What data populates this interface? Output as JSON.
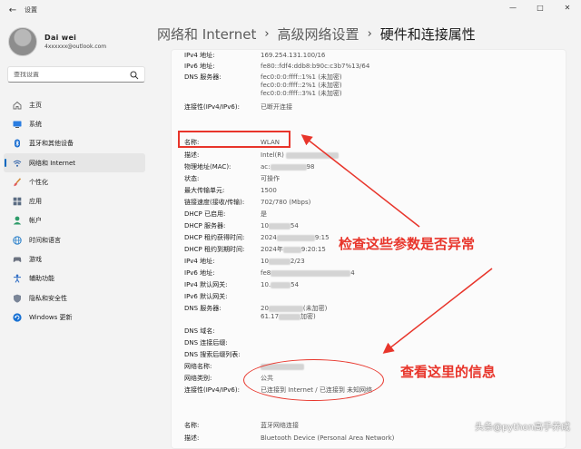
{
  "app": {
    "title": "设置"
  },
  "profile": {
    "name": "Dai wei",
    "email": "4xxxxxx@outlook.com"
  },
  "search": {
    "placeholder": "查找设置"
  },
  "nav": [
    {
      "label": "主页",
      "icon": "home-icon"
    },
    {
      "label": "系统",
      "icon": "system-icon"
    },
    {
      "label": "蓝牙和其他设备",
      "icon": "bluetooth-icon"
    },
    {
      "label": "网络和 Internet",
      "icon": "wifi-icon",
      "active": true
    },
    {
      "label": "个性化",
      "icon": "brush-icon"
    },
    {
      "label": "应用",
      "icon": "apps-icon"
    },
    {
      "label": "帐户",
      "icon": "account-icon"
    },
    {
      "label": "时间和语言",
      "icon": "globe-icon"
    },
    {
      "label": "游戏",
      "icon": "gamepad-icon"
    },
    {
      "label": "辅助功能",
      "icon": "accessibility-icon"
    },
    {
      "label": "隐私和安全性",
      "icon": "shield-icon"
    },
    {
      "label": "Windows 更新",
      "icon": "update-icon"
    }
  ],
  "breadcrumb": {
    "level1": "网络和 Internet",
    "level2": "高级网络设置",
    "level3": "硬件和连接属性"
  },
  "props": {
    "ipv4_top": {
      "k": "IPv4 地址:",
      "v": "169.254.131.100/16"
    },
    "ipv6_top": {
      "k": "IPv6 地址:",
      "v": "fe80::fdf4:ddb8:b90c:c3b7%13/64"
    },
    "dns_top": {
      "k": "DNS 服务器:",
      "v1": "fec0:0:0:ffff::1%1 (未加密)",
      "v2": "fec0:0:0:ffff::2%1 (未加密)",
      "v3": "fec0:0:0:ffff::3%1 (未加密)"
    },
    "conn_top": {
      "k": "连接性(IPv4/IPv6):",
      "v": "已断开连接"
    },
    "name": {
      "k": "名称:",
      "v": "WLAN"
    },
    "desc": {
      "k": "描述:",
      "v": "Intel(R)"
    },
    "mac": {
      "k": "物理地址(MAC):",
      "v": "ac:",
      "v2": "98"
    },
    "status": {
      "k": "状态:",
      "v": "可操作"
    },
    "mtu": {
      "k": "最大传输单元:",
      "v": "1500"
    },
    "speed": {
      "k": "链接速度(接收/传输):",
      "v": "702/780 (Mbps)"
    },
    "dhcp_enabled": {
      "k": "DHCP 已启用:",
      "v": "是"
    },
    "dhcp_server": {
      "k": "DHCP 服务器:",
      "v": "10",
      "v2": "54"
    },
    "dhcp_obtained": {
      "k": "DHCP 租约获得时间:",
      "v": "2024",
      "v2": "9:15"
    },
    "dhcp_expires": {
      "k": "DHCP 租约到期时间:",
      "v": "2024年",
      "v2": "9:20:15"
    },
    "ipv4": {
      "k": "IPv4 地址:",
      "v": "10",
      "v2": "2/23"
    },
    "ipv6": {
      "k": "IPv6 地址:",
      "v": "fe8",
      "v2": "4"
    },
    "ipv4_gw": {
      "k": "IPv4 默认网关:",
      "v": "10.",
      "v2": "54"
    },
    "ipv6_gw": {
      "k": "IPv6 默认网关:",
      "v": ""
    },
    "dns": {
      "k": "DNS 服务器:",
      "v1": "20",
      "v1b": "(未加密)",
      "v2": "61.17",
      "v2b": "加密)"
    },
    "dns_domain": {
      "k": "DNS 域名:",
      "v": ""
    },
    "dns_suffix": {
      "k": "DNS 连接后缀:",
      "v": ""
    },
    "dns_search": {
      "k": "DNS 搜索后缀列表:",
      "v": ""
    },
    "net_name": {
      "k": "网络名称:",
      "v": ""
    },
    "net_type": {
      "k": "网络类别:",
      "v": "公共"
    },
    "conn": {
      "k": "连接性(IPv4/IPv6):",
      "v": "已连接到 Internet / 已连接到 未知网络"
    },
    "bt_name": {
      "k": "名称:",
      "v": "蓝牙网络连接"
    },
    "bt_desc": {
      "k": "描述:",
      "v": "Bluetooth Device (Personal Area Network)"
    }
  },
  "annotations": {
    "check_params": "检查这些参数是否异常",
    "view_info": "查看这里的信息",
    "color": "#e8352b"
  },
  "watermark": "头条@python高手养成"
}
